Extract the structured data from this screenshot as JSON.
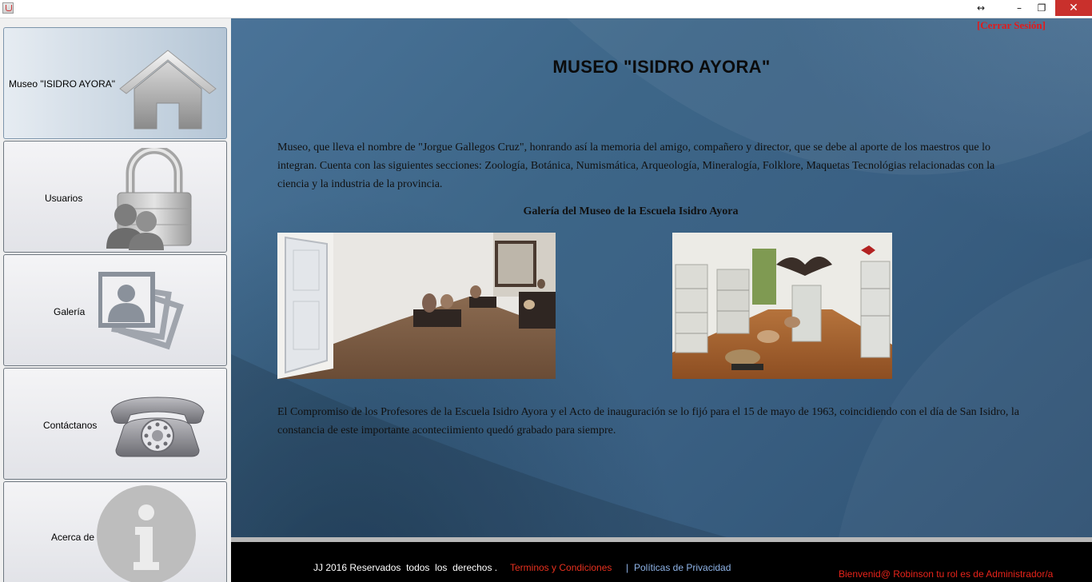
{
  "window": {
    "title": "",
    "controls": {
      "resize": "↔",
      "minimize": "–",
      "restore": "❐",
      "close": "✕"
    }
  },
  "sidebar": {
    "items": [
      {
        "label": "Museo \"ISIDRO AYORA\"",
        "icon": "home-icon",
        "active": true
      },
      {
        "label": "Usuarios",
        "icon": "users-lock-icon",
        "active": false
      },
      {
        "label": "Galería",
        "icon": "gallery-icon",
        "active": false
      },
      {
        "label": "Contáctanos",
        "icon": "phone-icon",
        "active": false
      },
      {
        "label": "Acerca de",
        "icon": "info-icon",
        "active": false
      }
    ]
  },
  "header": {
    "logout_label": "[Cerrar Sesión]",
    "title": "MUSEO \"ISIDRO AYORA\""
  },
  "content": {
    "intro": "Museo, que lleva el nombre de \"Jorgue Gallegos Cruz\", honrando así la  memoria del amigo,  compañero y director,  que se debe al aporte de los maestros que lo integran. Cuenta con las siguientes secciones: Zoología, Botánica, Numismática, Arqueología, Mineralogía, Folklore, Maquetas Tecnológias relacionadas con la ciencia y la industria de la provincia.",
    "gallery_title": "Galería del Museo de la Escuela Isidro Ayora",
    "photos": [
      "museum-room-photo",
      "museum-animals-photo"
    ],
    "closing": "El Compromiso de los Profesores de la Escuela Isidro Ayora y el Acto de inauguración se lo fijó para el 15 de mayo de 1963, coincidiendo con el día de San Isidro, la constancia de este importante aconteciimiento quedó grabado para siempre."
  },
  "footer": {
    "copyright": "JJ 2016 Reservados  todos  los  derechos .",
    "terms": "Terminos y Condiciones",
    "separator": "|",
    "privacy": "Políticas de Privacidad",
    "welcome": "Bienvenid@ Robinson tu rol es de Administrador/a"
  },
  "colors": {
    "accent_red": "#e21b1b",
    "link_blue": "#8fb4e8",
    "main_bg": "#3d6688",
    "footer_bg": "#000000"
  }
}
